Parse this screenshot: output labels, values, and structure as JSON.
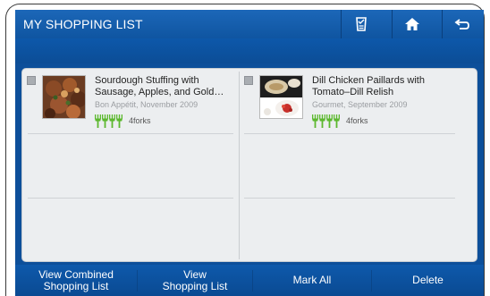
{
  "header": {
    "title": "MY SHOPPING LIST",
    "buttons": [
      {
        "icon": "shopping-list-icon"
      },
      {
        "icon": "home-icon"
      },
      {
        "icon": "back-arrow-icon"
      }
    ]
  },
  "recipes": [
    {
      "title": "Sourdough Stuffing with Sausage, Apples, and Gold…",
      "source": "Bon Appétit, November 2009",
      "rating_forks": 4,
      "rating_label": "4forks",
      "checked": false
    },
    {
      "title": "Dill Chicken Paillards with Tomato–Dill Relish",
      "source": "Gourmet, September 2009",
      "rating_forks": 4,
      "rating_label": "4forks",
      "checked": false
    }
  ],
  "footer": {
    "view_combined_line1": "View Combined",
    "view_combined_line2": "Shopping List",
    "view_line1": "View",
    "view_line2": "Shopping List",
    "mark_all": "Mark All",
    "delete": "Delete"
  },
  "colors": {
    "header_blue": "#1c67b8",
    "panel_bg": "#eceef0",
    "fork_green": "#5cb82e"
  }
}
